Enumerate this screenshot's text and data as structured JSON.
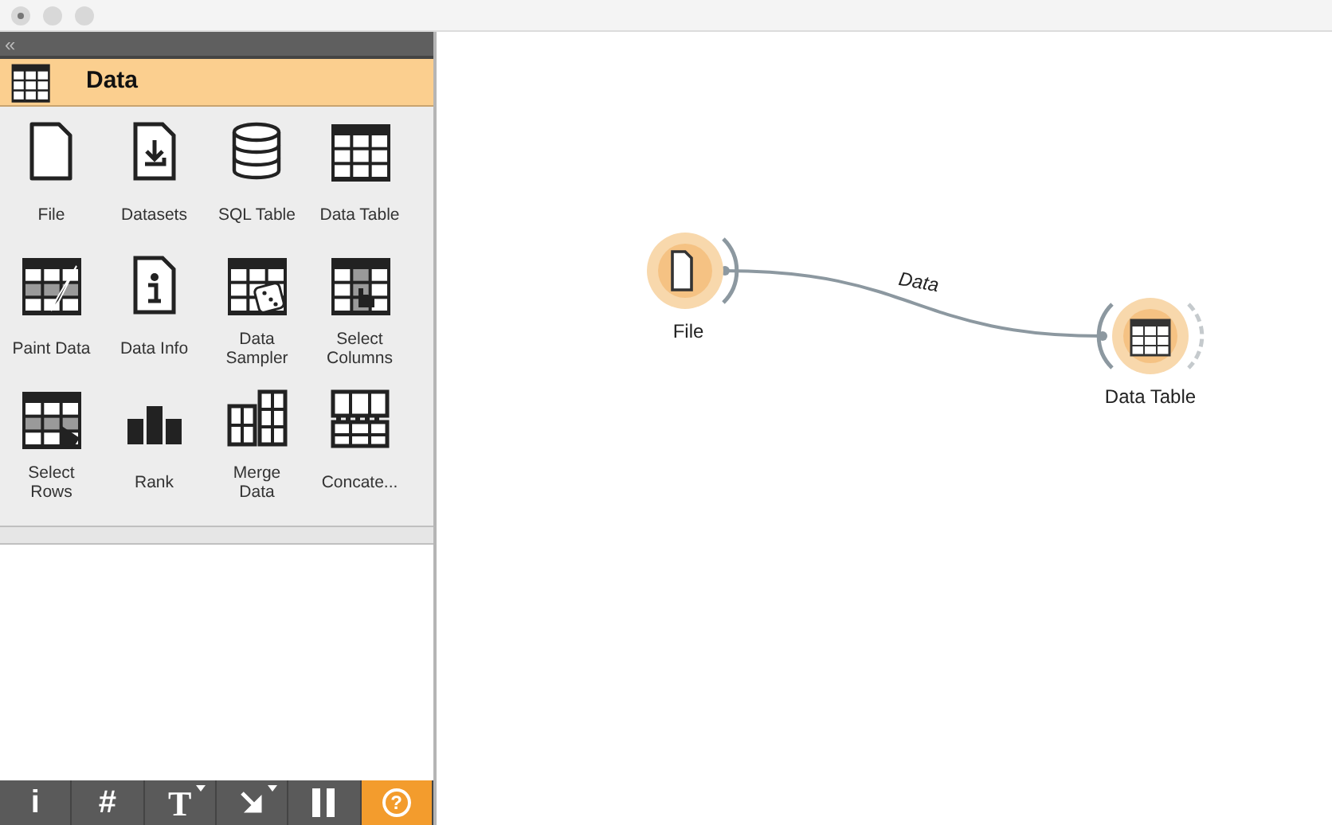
{
  "sidebar": {
    "collapse_glyph": "«",
    "category": {
      "title": "Data",
      "kind": "table"
    },
    "widgets": [
      {
        "label": "File",
        "kind": "file"
      },
      {
        "label": "Datasets",
        "kind": "datasets"
      },
      {
        "label": "SQL Table",
        "kind": "sql"
      },
      {
        "label": "Data Table",
        "kind": "table"
      },
      {
        "label": "Paint Data",
        "kind": "paint"
      },
      {
        "label": "Data Info",
        "kind": "info"
      },
      {
        "label": "Data Sampler",
        "kind": "sampler"
      },
      {
        "label": "Select Columns",
        "kind": "columns"
      },
      {
        "label": "Select Rows",
        "kind": "rows"
      },
      {
        "label": "Rank",
        "kind": "rank"
      },
      {
        "label": "Merge Data",
        "kind": "merge"
      },
      {
        "label": "Concate...",
        "kind": "concatenate"
      }
    ],
    "toolbar": [
      {
        "kind": "text",
        "text": "i",
        "menu": false,
        "selected": false
      },
      {
        "kind": "text",
        "text": "#",
        "menu": false,
        "selected": false
      },
      {
        "kind": "text",
        "text": "T",
        "menu": true,
        "selected": false
      },
      {
        "kind": "arrow",
        "menu": true,
        "selected": false
      },
      {
        "kind": "pause",
        "menu": false,
        "selected": false
      },
      {
        "kind": "help",
        "text": "?",
        "menu": false,
        "selected": true
      }
    ]
  },
  "canvas": {
    "nodes": [
      {
        "label": "File",
        "kind": "file"
      },
      {
        "label": "Data Table",
        "kind": "table"
      }
    ],
    "links": [
      {
        "label": "Data"
      }
    ]
  }
}
